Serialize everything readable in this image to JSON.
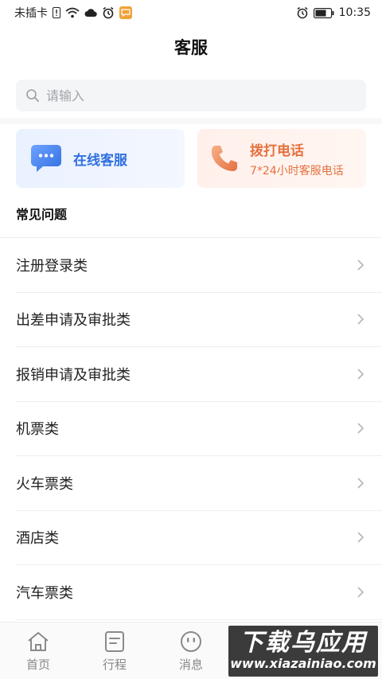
{
  "status_bar": {
    "carrier": "未插卡",
    "time": "10:35",
    "icons": [
      "sim-alert-icon",
      "wifi-icon",
      "cloud-icon",
      "alarm-clock-icon",
      "message-icon",
      "battery-icon"
    ]
  },
  "header": {
    "title": "客服"
  },
  "search": {
    "placeholder": "请输入"
  },
  "cards": {
    "online": {
      "title": "在线客服",
      "icon": "chat-bubble-icon",
      "color": "#2f6fe0"
    },
    "phone": {
      "title": "拨打电话",
      "subtitle": "7*24小时客服电话",
      "icon": "phone-icon",
      "color": "#e5713f"
    }
  },
  "faq": {
    "title": "常见问题",
    "items": [
      {
        "label": "注册登录类"
      },
      {
        "label": "出差申请及审批类"
      },
      {
        "label": "报销申请及审批类"
      },
      {
        "label": "机票类"
      },
      {
        "label": "火车票类"
      },
      {
        "label": "酒店类"
      },
      {
        "label": "汽车票类"
      }
    ]
  },
  "tab_bar": {
    "tabs": [
      {
        "label": "首页",
        "icon": "home-icon"
      },
      {
        "label": "行程",
        "icon": "itinerary-icon"
      },
      {
        "label": "消息",
        "icon": "message-face-icon"
      },
      {
        "label": "",
        "icon": "service-icon"
      },
      {
        "label": "",
        "icon": "profile-icon"
      }
    ]
  },
  "watermark": {
    "main": "下载乌应用",
    "url": "www.xiazainiao.com"
  }
}
